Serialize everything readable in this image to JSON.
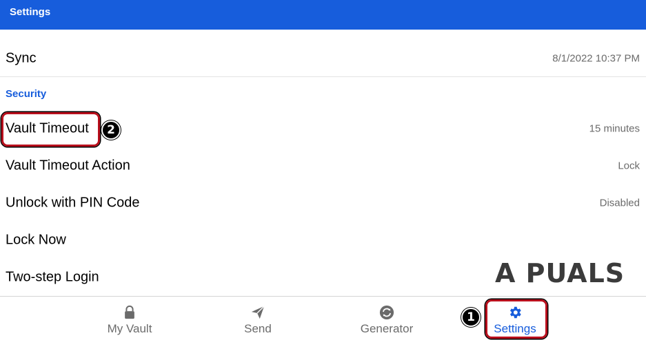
{
  "header": {
    "title": "Settings"
  },
  "rows": {
    "sync": {
      "label": "Sync",
      "value": "8/1/2022 10:37 PM"
    },
    "vault_timeout": {
      "label": "Vault Timeout",
      "value": "15 minutes"
    },
    "vault_timeout_action": {
      "label": "Vault Timeout Action",
      "value": "Lock"
    },
    "unlock_pin": {
      "label": "Unlock with PIN Code",
      "value": "Disabled"
    },
    "lock_now": {
      "label": "Lock Now"
    },
    "two_step": {
      "label": "Two-step Login"
    }
  },
  "section": {
    "security": "Security"
  },
  "bottom_nav": {
    "items": [
      {
        "label": "My Vault",
        "icon": "lock-icon"
      },
      {
        "label": "Send",
        "icon": "paper-plane-icon"
      },
      {
        "label": "Generator",
        "icon": "refresh-icon"
      },
      {
        "label": "Settings",
        "icon": "gear-icon",
        "active": true
      }
    ]
  },
  "annotations": {
    "badge_1": "1",
    "badge_2": "2"
  },
  "watermark": "A PUALS",
  "colors": {
    "brand": "#175ddc",
    "callout": "#b80f1c",
    "value_text": "#6b6b6b"
  }
}
